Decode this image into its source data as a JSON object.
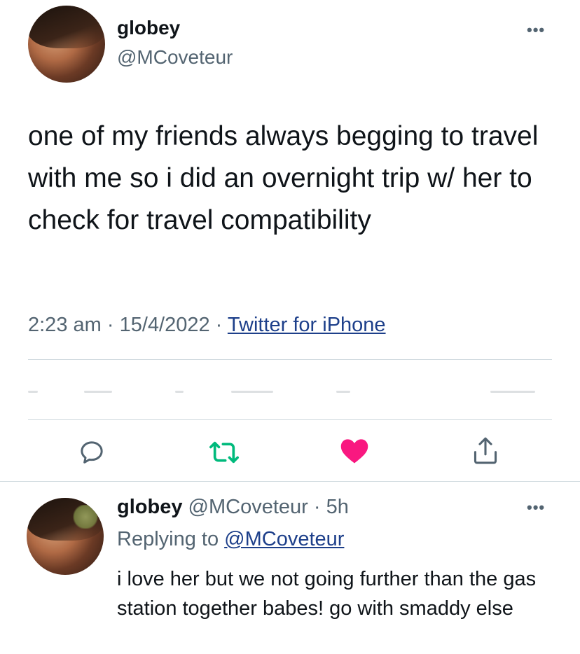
{
  "tweet": {
    "author_name": "globey",
    "author_handle": "@MCoveteur",
    "text": "one of my friends always begging to travel with me so i did an overnight trip w/ her to check for travel compatibility",
    "time": "2:23 am",
    "date": "15/4/2022",
    "separator": "·",
    "source": "Twitter for iPhone",
    "more_label": "•••"
  },
  "actions": {
    "reply_icon": "reply-icon",
    "retweet_icon": "retweet-icon",
    "like_icon": "like-icon",
    "share_icon": "share-icon",
    "retweet_color": "#00ba7c",
    "like_color": "#f91880",
    "icon_color": "#536471"
  },
  "reply": {
    "author_name": "globey",
    "author_handle": "@MCoveteur",
    "separator": "·",
    "age": "5h",
    "replying_to_label": "Replying to",
    "replying_to_handle": "@MCoveteur",
    "text": "i love her but we not going further than the gas station together babes! go with smaddy else",
    "more_label": "•••"
  }
}
